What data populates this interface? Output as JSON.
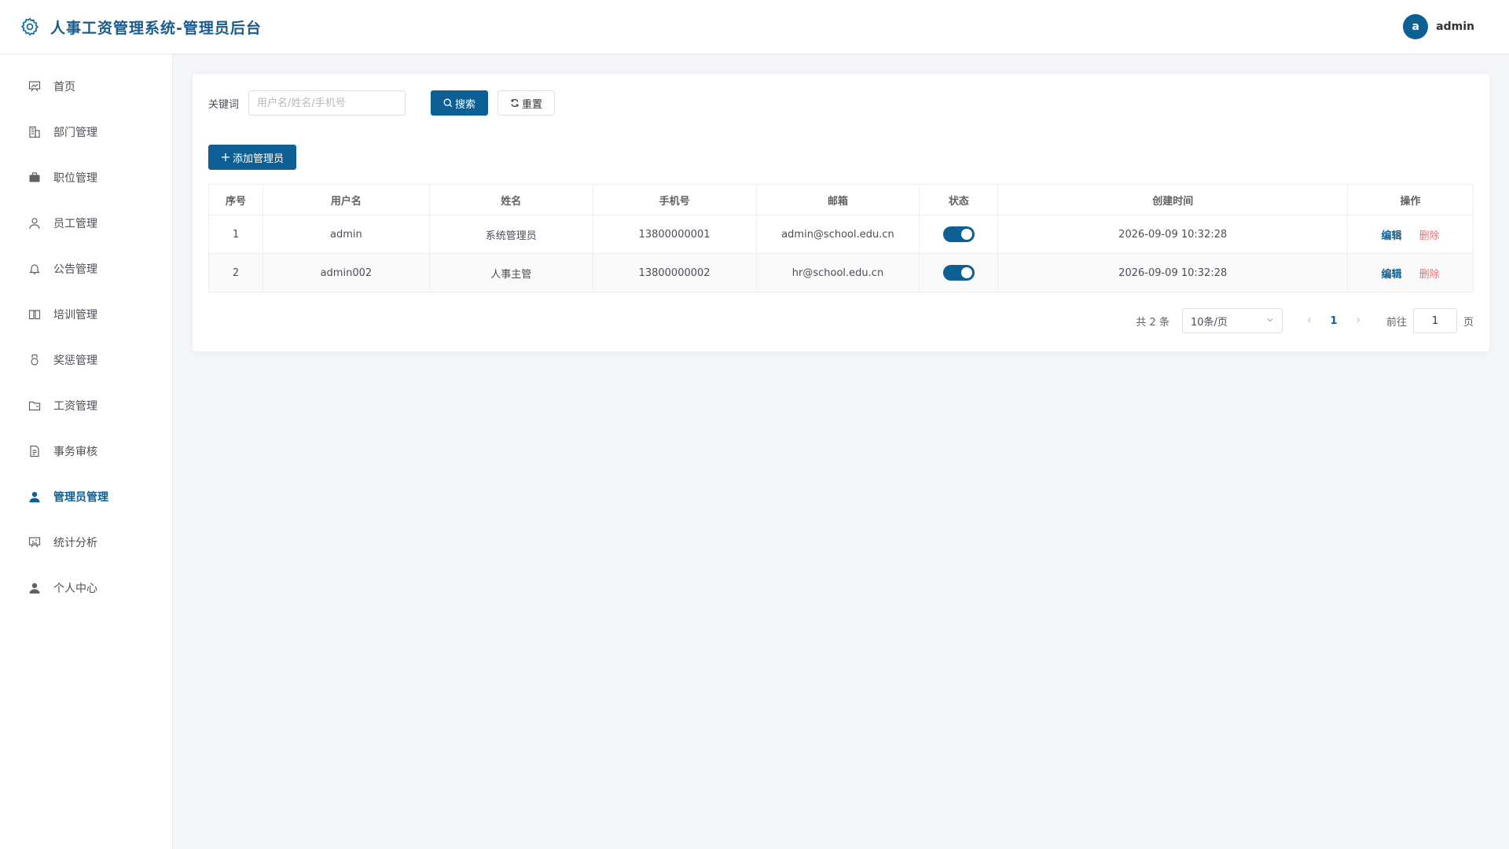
{
  "header": {
    "title": "人事工资管理系统-管理员后台",
    "avatar_letter": "a",
    "username": "admin",
    "logo_icon": "gear-icon"
  },
  "sidebar": {
    "items": [
      {
        "label": "首页",
        "icon": "chart-board-icon",
        "active": false
      },
      {
        "label": "部门管理",
        "icon": "building-icon",
        "active": false
      },
      {
        "label": "职位管理",
        "icon": "briefcase-icon",
        "active": false
      },
      {
        "label": "员工管理",
        "icon": "user-outline-icon",
        "active": false
      },
      {
        "label": "公告管理",
        "icon": "bell-icon",
        "active": false
      },
      {
        "label": "培训管理",
        "icon": "book-icon",
        "active": false
      },
      {
        "label": "奖惩管理",
        "icon": "medal-icon",
        "active": false
      },
      {
        "label": "工资管理",
        "icon": "wallet-icon",
        "active": false
      },
      {
        "label": "事务审核",
        "icon": "document-icon",
        "active": false
      },
      {
        "label": "管理员管理",
        "icon": "user-filled-icon",
        "active": true
      },
      {
        "label": "统计分析",
        "icon": "presentation-icon",
        "active": false
      },
      {
        "label": "个人中心",
        "icon": "person-icon",
        "active": false
      }
    ]
  },
  "search": {
    "label": "关键词",
    "placeholder": "用户名/姓名/手机号",
    "value": "",
    "search_label": "搜索",
    "reset_label": "重置"
  },
  "toolbar": {
    "add_label": "添加管理员"
  },
  "table": {
    "columns": [
      "序号",
      "用户名",
      "姓名",
      "手机号",
      "邮箱",
      "状态",
      "创建时间",
      "操作"
    ],
    "rows": [
      {
        "index": "1",
        "username": "admin",
        "name": "系统管理员",
        "phone": "13800000001",
        "email": "admin@school.edu.cn",
        "enabled": true,
        "created": "2026-09-09 10:32:28"
      },
      {
        "index": "2",
        "username": "admin002",
        "name": "人事主管",
        "phone": "13800000002",
        "email": "hr@school.edu.cn",
        "enabled": true,
        "created": "2026-09-09 10:32:28"
      }
    ],
    "edit_label": "编辑",
    "delete_label": "删除"
  },
  "pagination": {
    "total_text": "共 2 条",
    "page_size": "10条/页",
    "current_page": "1",
    "goto_label": "前往",
    "goto_value": "1",
    "page_suffix": "页"
  },
  "colors": {
    "primary": "#0e5f93",
    "danger": "#f56c6c"
  }
}
